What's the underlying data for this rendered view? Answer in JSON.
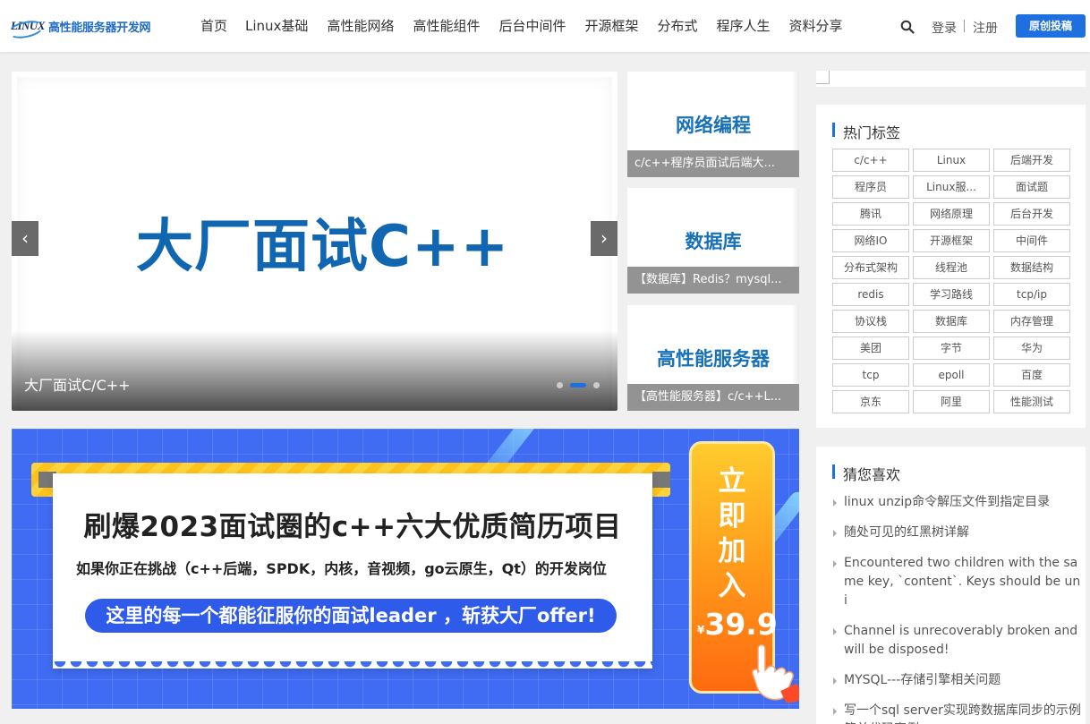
{
  "site": {
    "logo_mark": "LINUX",
    "logo_text": "高性能服务器开发网"
  },
  "nav": {
    "items": [
      "首页",
      "Linux基础",
      "高性能网络",
      "高性能组件",
      "后台中间件",
      "开源框架",
      "分布式",
      "程序人生",
      "资料分享"
    ]
  },
  "header": {
    "login": "登录",
    "register": "注册",
    "submit": "原创投稿",
    "search_icon": "search-icon",
    "accent_color": "#1e6fe0"
  },
  "carousel": {
    "headline": "大厂面试C++",
    "caption": "大厂面试C/C++",
    "prev": "‹",
    "next": "›",
    "active_slide": 2,
    "slide_count": 3
  },
  "cards": [
    {
      "title": "网络编程",
      "caption": "c/c++程序员面试后端大..."
    },
    {
      "title": "数据库",
      "caption": "【数据库】Redis？mysql..."
    },
    {
      "title": "高性能服务器",
      "caption": "【高性能服务器】c/c++L..."
    }
  ],
  "banner": {
    "title": "刷爆2023面试圈的c++六大优质简历项目",
    "subtitle": "如果你正在挑战（c++后端，SPDK，内核，音视频，go云原生，Qt）的开发岗位",
    "pill": "这里的每一个都能征服你的面试leader ，斩获大厂offer!",
    "join_chars": [
      "立",
      "即",
      "加",
      "入"
    ],
    "currency": "¥",
    "price": "39.9"
  },
  "tags": {
    "heading": "热门标签",
    "items": [
      "c/c++",
      "Linux",
      "后端开发",
      "程序员",
      "Linux服...",
      "面试题",
      "腾讯",
      "网络原理",
      "后台开发",
      "网络IO",
      "开源框架",
      "中间件",
      "分布式架构",
      "线程池",
      "数据结构",
      "redis",
      "学习路线",
      "tcp/ip",
      "协议栈",
      "数据库",
      "内存管理",
      "美团",
      "字节",
      "华为",
      "tcp",
      "epoll",
      "百度",
      "京东",
      "阿里",
      "性能测试"
    ]
  },
  "guess": {
    "heading": "猜您喜欢",
    "items": [
      "linux unzip命令解压文件到指定目录",
      "随处可见的红黑树详解",
      "Encountered two children with the same key, `content`. Keys should be uni",
      "Channel is unrecoverably broken and will be disposed!",
      "MYSQL---存储引擎相关问题",
      "写一个sql server实现跨数据库同步的示例 简单代码案例"
    ]
  }
}
